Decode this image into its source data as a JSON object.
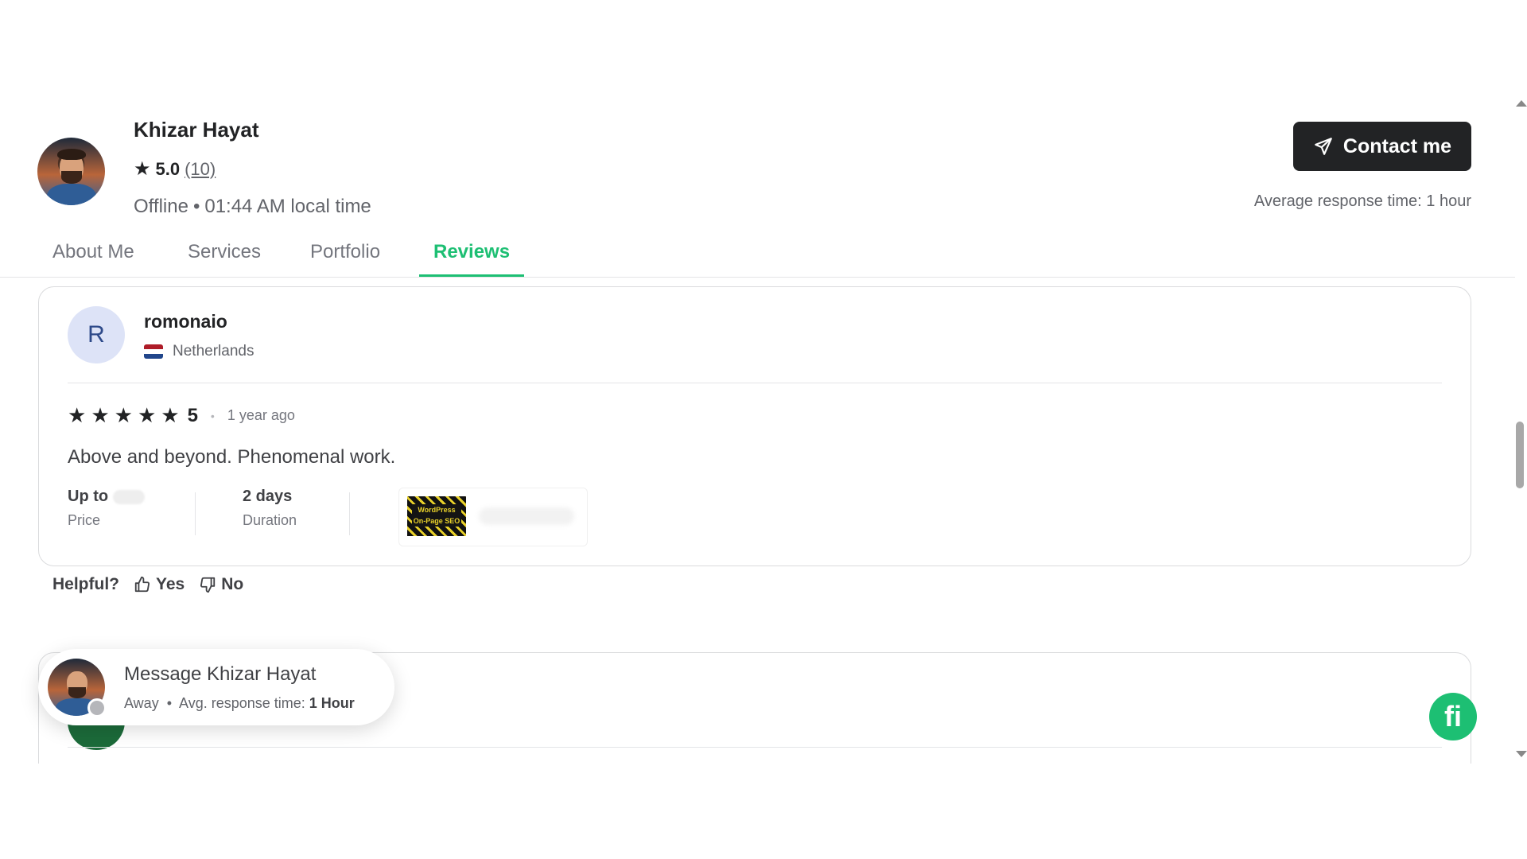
{
  "seller": {
    "name": "Khizar Hayat",
    "rating": "5.0",
    "review_count": "(10)",
    "status": "Offline",
    "local_time": "01:44 AM local time",
    "contact_label": "Contact me",
    "avg_response": "Average response time: 1 hour"
  },
  "tabs": [
    {
      "label": "About Me",
      "active": false
    },
    {
      "label": "Services",
      "active": false
    },
    {
      "label": "Portfolio",
      "active": false
    },
    {
      "label": "Reviews",
      "active": true
    }
  ],
  "review": {
    "avatar_letter": "R",
    "username": "romonaio",
    "country": "Netherlands",
    "stars": 5,
    "rating_value": "5",
    "time_ago": "1 year ago",
    "text": "Above and beyond. Phenomenal work.",
    "price_label": "Up to",
    "price_caption": "Price",
    "duration_value": "2 days",
    "duration_caption": "Duration",
    "gig_thumb_text": "WordPress On-Page SEO"
  },
  "helpful": {
    "label": "Helpful?",
    "yes": "Yes",
    "no": "No"
  },
  "message_bubble": {
    "title": "Message Khizar Hayat",
    "status": "Away",
    "avg_label": "Avg. response time:",
    "avg_value": "1 Hour"
  },
  "fiverr_logo": "fi",
  "colors": {
    "accent": "#1dbf73",
    "dark": "#222325",
    "muted": "#62646a"
  }
}
